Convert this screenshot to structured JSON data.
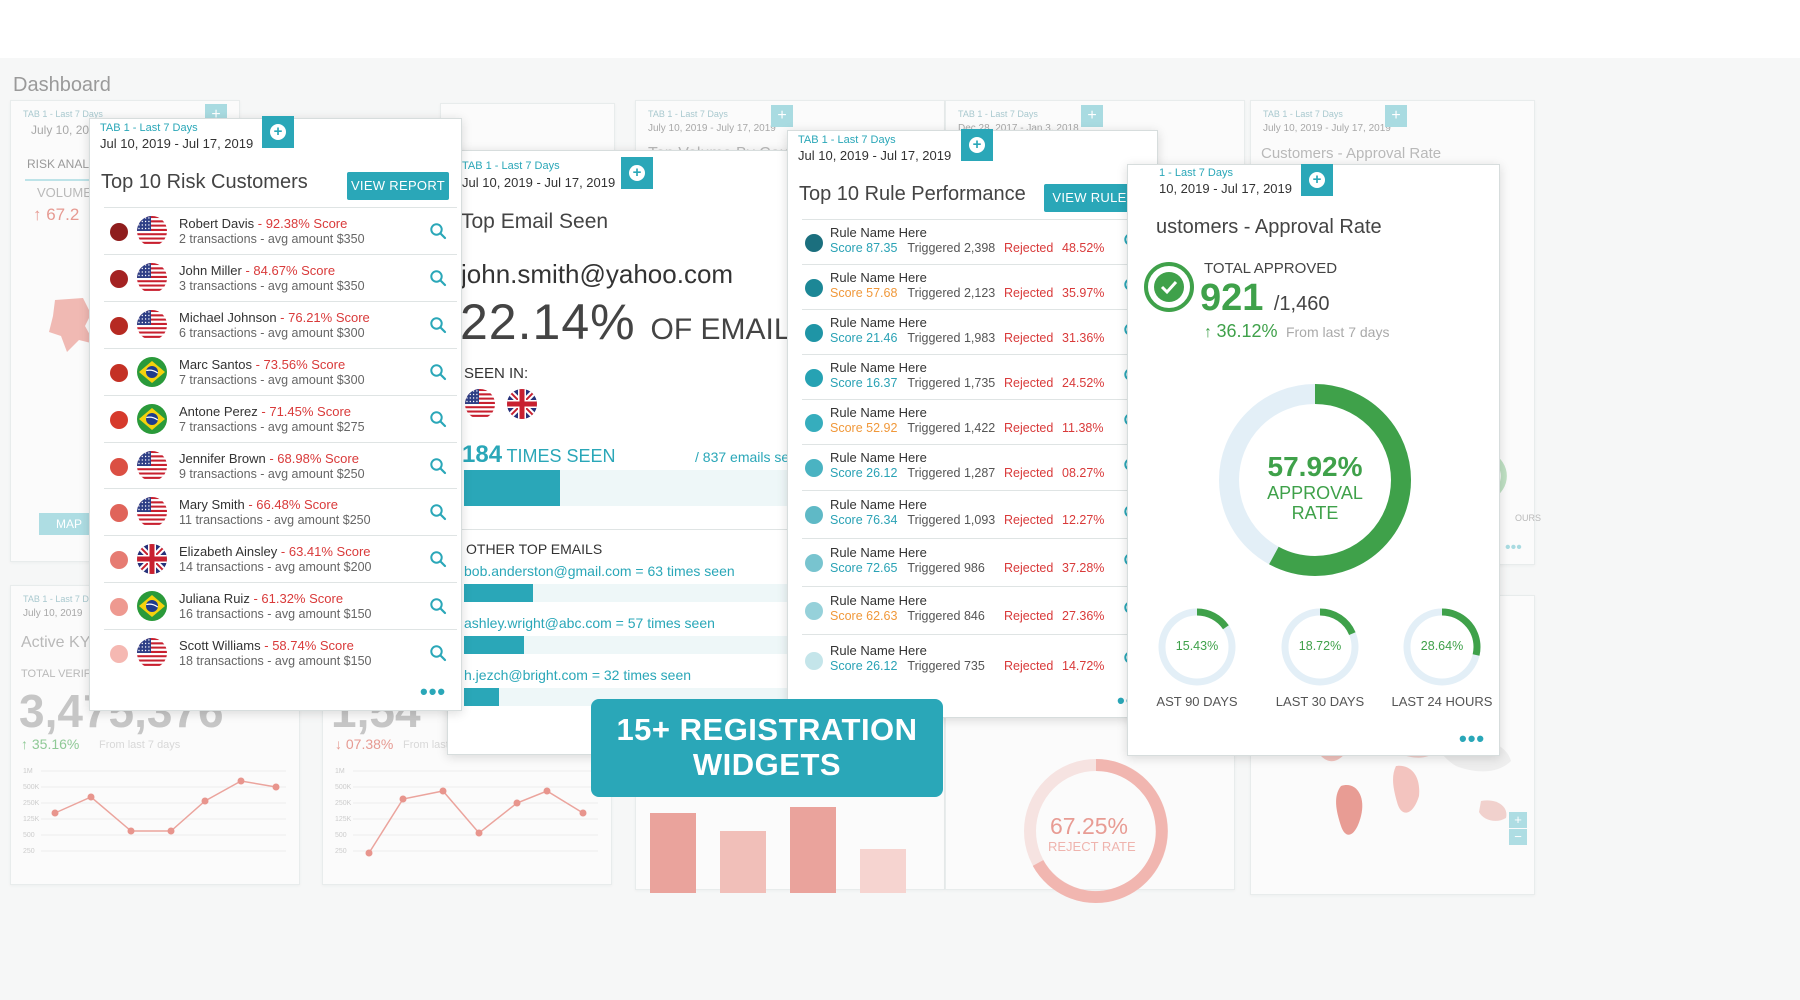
{
  "page": {
    "title": "Dashboard"
  },
  "background": {
    "tab_short": "TAB 1 - Last 7 Days",
    "date_a": "July 10, 2019",
    "date_b": "July 10, 2019 - July 17, 2019",
    "date_c": "Dec 28, 2017 - Jan 3, 2018",
    "date_d": "July 10, 2019 - July 17, 2019",
    "date_e": "July 10, 2019",
    "risk_analysis": "RISK ANAL",
    "volume": "VOLUME",
    "volume_pct": "↑ 67.2",
    "map_btn": "MAP",
    "top_volume_title": "Top Volume By Count",
    "approval_title": "Customers - Approval Rate",
    "active_kyc": "Active KYC",
    "total_verified": "TOTAL VERIF",
    "big_count": "3,475,376",
    "growth_up": "↑ 35.16%",
    "growth_up_note": "From last 7 days",
    "big_count_2": "1,54",
    "growth_down": "↓ 07.38%",
    "growth_down_note": "From last",
    "reject_pct": "67.25%",
    "reject_label": "REJECT RATE",
    "hours_partial": "OURS",
    "y_ticks": [
      "1M",
      "500K",
      "250K",
      "125K",
      "500",
      "250"
    ]
  },
  "risk_widget": {
    "tab": "TAB 1 - Last 7 Days",
    "date_range": "Jul 10, 2019 - Jul 17, 2019",
    "title": "Top 10 Risk Customers",
    "button": "VIEW REPORT",
    "customers": [
      {
        "name": "Robert Davis",
        "score": "92.38% Score",
        "sub": "2 transactions - avg amount $350",
        "flag": "us",
        "dot": "#8f1d1d"
      },
      {
        "name": "John Miller",
        "score": "84.67% Score",
        "sub": "3 transactions - avg amount $350",
        "flag": "us",
        "dot": "#a42222"
      },
      {
        "name": "Michael Johnson",
        "score": "76.21% Score",
        "sub": "6 transactions - avg amount $300",
        "flag": "us",
        "dot": "#b62a22"
      },
      {
        "name": "Marc Santos",
        "score": "73.56% Score",
        "sub": "7 transactions - avg amount $300",
        "flag": "br",
        "dot": "#c43125"
      },
      {
        "name": "Antone Perez",
        "score": "71.45% Score",
        "sub": "7 transactions - avg amount $275",
        "flag": "br",
        "dot": "#d63a2c"
      },
      {
        "name": "Jennifer Brown",
        "score": "68.98% Score",
        "sub": "9 transactions - avg amount $250",
        "flag": "us",
        "dot": "#db4f43"
      },
      {
        "name": "Mary Smith",
        "score": "66.48% Score",
        "sub": "11 transactions - avg amount $250",
        "flag": "us",
        "dot": "#e0645a"
      },
      {
        "name": "Elizabeth Ainsley",
        "score": "63.41% Score",
        "sub": "14 transactions - avg amount $200",
        "flag": "uk",
        "dot": "#e67b72"
      },
      {
        "name": "Juliana Ruiz",
        "score": "61.32% Score",
        "sub": "16 transactions - avg amount $150",
        "flag": "br",
        "dot": "#ee9990"
      },
      {
        "name": "Scott Williams",
        "score": "58.74% Score",
        "sub": "18 transactions - avg amount $150",
        "flag": "us",
        "dot": "#f5b8b2"
      }
    ]
  },
  "email_widget": {
    "tab": "TAB 1 - Last 7 Days",
    "date_range": "Jul 10, 2019 - Jul 17, 2019",
    "title": "Top Email Seen",
    "email": "john.smith@yahoo.com",
    "percent": "22.14%",
    "percent_suffix": "OF EMAILS",
    "seen_in_label": "SEEN IN:",
    "times_seen_count": "184",
    "times_seen_label": "TIMES SEEN",
    "total_emails": "/ 837 emails se",
    "main_bar_fraction": 0.22,
    "other_title": "OTHER TOP EMAILS",
    "others": [
      {
        "text": "bob.anderston@gmail.com = 63 times seen",
        "fraction": 0.08
      },
      {
        "text": "ashley.wright@abc.com = 57 times seen",
        "fraction": 0.07
      },
      {
        "text": "h.jezch@bright.com = 32 times seen",
        "fraction": 0.04
      }
    ]
  },
  "rule_widget": {
    "tab": "TAB 1 - Last 7 Days",
    "date_range": "Jul 10, 2019 - Jul 17, 2019",
    "title": "Top 10 Rule Performance",
    "button": "VIEW RULES",
    "score_word": "Score",
    "triggered_word": "Triggered",
    "rejected_word": "Rejected",
    "rules": [
      {
        "name": "Rule Name Here",
        "score": "87.35",
        "triggered": "2,398",
        "rejected": "48.52%",
        "dot": "#1b6f7e",
        "orange": false
      },
      {
        "name": "Rule Name Here",
        "score": "57.68",
        "triggered": "2,123",
        "rejected": "35.97%",
        "dot": "#1c8796",
        "orange": true
      },
      {
        "name": "Rule Name Here",
        "score": "21.46",
        "triggered": "1,983",
        "rejected": "31.36%",
        "dot": "#1f95a6",
        "orange": false
      },
      {
        "name": "Rule Name Here",
        "score": "16.37",
        "triggered": "1,735",
        "rejected": "24.52%",
        "dot": "#26a2b3",
        "orange": false
      },
      {
        "name": "Rule Name Here",
        "score": "52.92",
        "triggered": "1,422",
        "rejected": "11.38%",
        "dot": "#36adbd",
        "orange": true
      },
      {
        "name": "Rule Name Here",
        "score": "26.12",
        "triggered": "1,287",
        "rejected": "08.27%",
        "dot": "#4ab3c2",
        "orange": false
      },
      {
        "name": "Rule Name Here",
        "score": "76.34",
        "triggered": "1,093",
        "rejected": "12.27%",
        "dot": "#5fb9c6",
        "orange": false
      },
      {
        "name": "Rule Name Here",
        "score": "72.65",
        "triggered": "986",
        "rejected": "37.28%",
        "dot": "#78c4cf",
        "orange": false
      },
      {
        "name": "Rule Name Here",
        "score": "62.63",
        "triggered": "846",
        "rejected": "27.36%",
        "dot": "#96d1da",
        "orange": true
      },
      {
        "name": "Rule Name Here",
        "score": "26.12",
        "triggered": "735",
        "rejected": "14.72%",
        "dot": "#c4e5ea",
        "orange": false
      }
    ]
  },
  "approval_widget": {
    "tab": "1 - Last 7 Days",
    "date_range": "10, 2019 - Jul 17, 2019",
    "title": "ustomers - Approval Rate",
    "total_label": "TOTAL APPROVED",
    "approved": "921",
    "total": "/1,460",
    "change": "36.12%",
    "change_note": "From last 7 days",
    "ring_pct": "57.92%",
    "ring_label_1": "APPROVAL",
    "ring_label_2": "RATE",
    "ring_fraction": 0.5792,
    "small_rings": [
      {
        "pct": "15.43%",
        "fraction": 0.1543,
        "label": "AST 90 DAYS"
      },
      {
        "pct": "18.72%",
        "fraction": 0.1872,
        "label": "LAST 30 DAYS"
      },
      {
        "pct": "28.64%",
        "fraction": 0.2864,
        "label": "LAST 24 HOURS"
      }
    ]
  },
  "banner": {
    "line1": "15+ REGISTRATION",
    "line2": "WIDGETS"
  },
  "colors": {
    "accent": "#2aa7b8",
    "red": "#d93a3a",
    "green": "#3fa14a",
    "orange": "#f0983a"
  }
}
